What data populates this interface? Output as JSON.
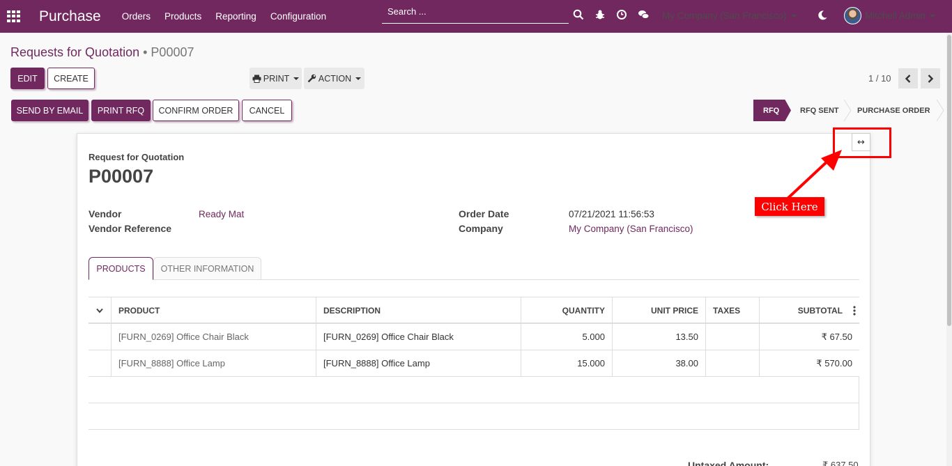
{
  "navbar": {
    "app_title": "Purchase",
    "menu": [
      "Orders",
      "Products",
      "Reporting",
      "Configuration"
    ],
    "search_placeholder": "Search ...",
    "company": "My Company (San Francisco)",
    "user": "Mitchell Admin",
    "icons": [
      "apps-icon",
      "search-icon",
      "bug-icon",
      "clock-icon",
      "chat-icon",
      "moon-icon"
    ]
  },
  "breadcrumb": {
    "parent": "Requests for Quotation",
    "separator": "•",
    "current": "P00007"
  },
  "control": {
    "edit": "EDIT",
    "create": "CREATE",
    "print": "PRINT",
    "action": "ACTION",
    "pager": "1 / 10"
  },
  "header_buttons": {
    "send_email": "SEND BY EMAIL",
    "print_rfq": "PRINT RFQ",
    "confirm": "CONFIRM ORDER",
    "cancel": "CANCEL"
  },
  "statusbar": {
    "stages": [
      "RFQ",
      "RFQ SENT",
      "PURCHASE ORDER"
    ],
    "active": "RFQ"
  },
  "annotation": {
    "label": "Click Here",
    "expand_glyph": "↔"
  },
  "form": {
    "doc_label": "Request for Quotation",
    "name": "P00007",
    "vendor_label": "Vendor",
    "vendor": "Ready Mat",
    "vendor_ref_label": "Vendor Reference",
    "order_date_label": "Order Date",
    "order_date": "07/21/2021 11:56:53",
    "company_label": "Company",
    "company": "My Company (San Francisco)"
  },
  "tabs": [
    "PRODUCTS",
    "OTHER INFORMATION"
  ],
  "table": {
    "headers": [
      "PRODUCT",
      "DESCRIPTION",
      "QUANTITY",
      "UNIT PRICE",
      "TAXES",
      "SUBTOTAL"
    ],
    "rows": [
      {
        "product": "[FURN_0269] Office Chair Black",
        "description": "[FURN_0269] Office Chair Black",
        "quantity": "5.000",
        "unit_price": "13.50",
        "taxes": "",
        "subtotal": "₹ 67.50"
      },
      {
        "product": "[FURN_8888] Office Lamp",
        "description": "[FURN_8888] Office Lamp",
        "quantity": "15.000",
        "unit_price": "38.00",
        "taxes": "",
        "subtotal": "₹ 570.00"
      }
    ]
  },
  "totals": {
    "untaxed_label": "Untaxed Amount:",
    "untaxed_value": "₹ 637.50"
  }
}
